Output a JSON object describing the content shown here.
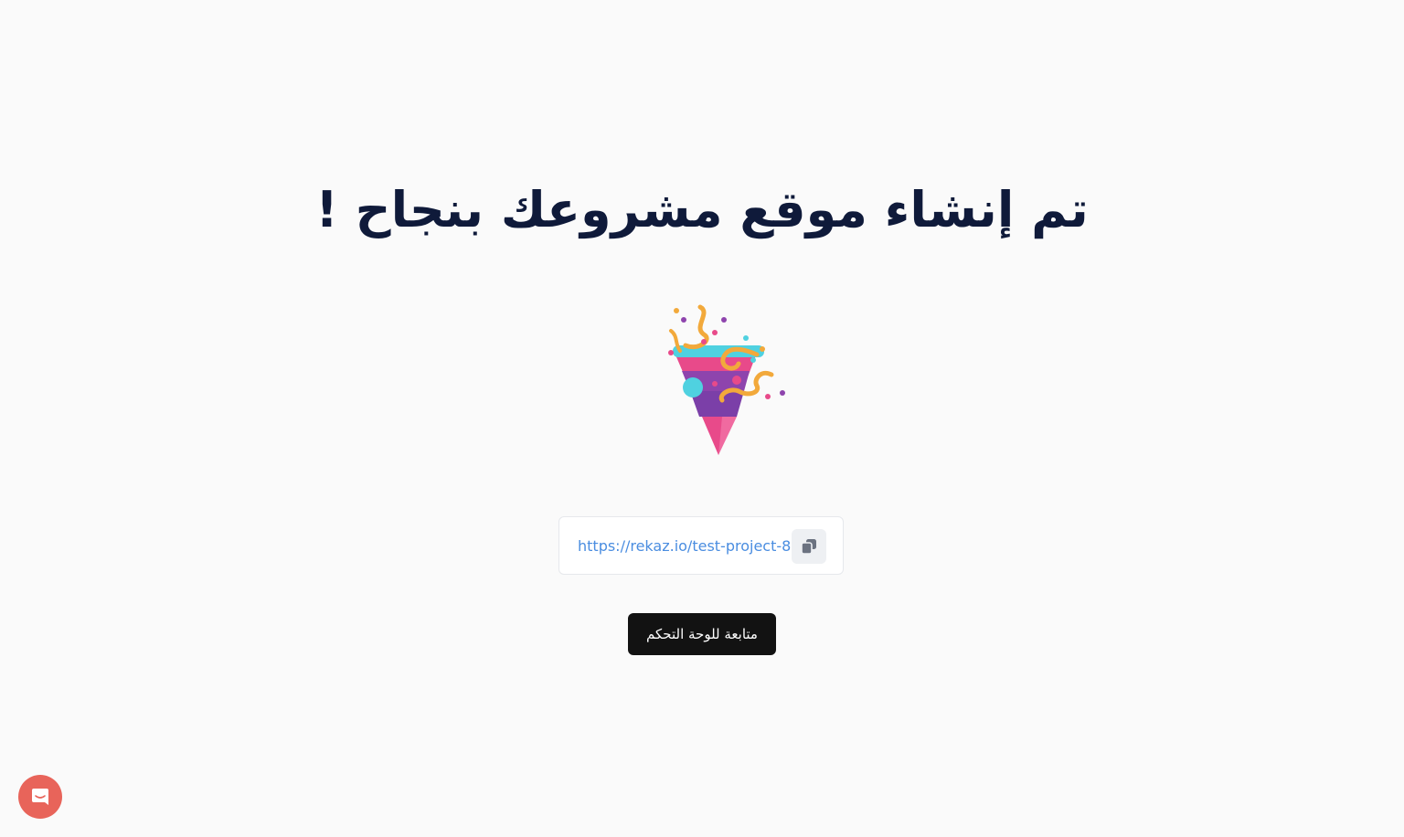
{
  "success": {
    "title": "تم إنشاء موقع مشروعك بنجاح !",
    "illustration": "party-popper-icon"
  },
  "site_link": {
    "url": "https://rekaz.io/test-project-8",
    "copy_icon": "copy-icon"
  },
  "actions": {
    "continue_label": "متابعة للوحة التحكم"
  },
  "support": {
    "icon": "chat-icon"
  },
  "colors": {
    "background": "#fafafa",
    "title": "#0f1a3a",
    "link": "#4a8de0",
    "primary_button": "#121212",
    "chat_launcher": "#e8645a",
    "popper_pink": "#e84a8a",
    "popper_purple": "#8e44ad",
    "popper_cyan": "#4fd1e0",
    "confetti_orange": "#f2a93b"
  }
}
